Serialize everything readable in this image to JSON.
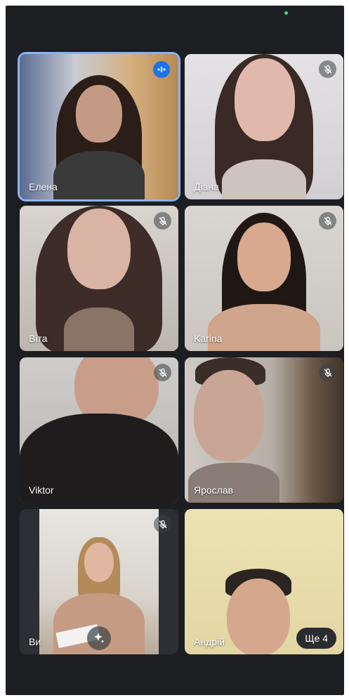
{
  "participants": [
    {
      "name": "Елена",
      "muted": false,
      "speaking": true
    },
    {
      "name": "Діана",
      "muted": true
    },
    {
      "name": "Віта",
      "muted": true
    },
    {
      "name": "Karina",
      "muted": true
    },
    {
      "name": "Viktor",
      "muted": true
    },
    {
      "name": "Ярослав",
      "muted": true
    },
    {
      "name": "Ви",
      "muted": true
    },
    {
      "name": "Андрій",
      "muted": false
    }
  ],
  "more_participants_label": "Ще 4",
  "icons": {
    "mic_off": "mic-off-icon",
    "speaking": "audio-wave-icon",
    "effects": "sparkle-icon"
  },
  "colors": {
    "background": "#1c1e22",
    "active_border": "#8ab4f8",
    "speaking_badge": "#1a73e8"
  }
}
